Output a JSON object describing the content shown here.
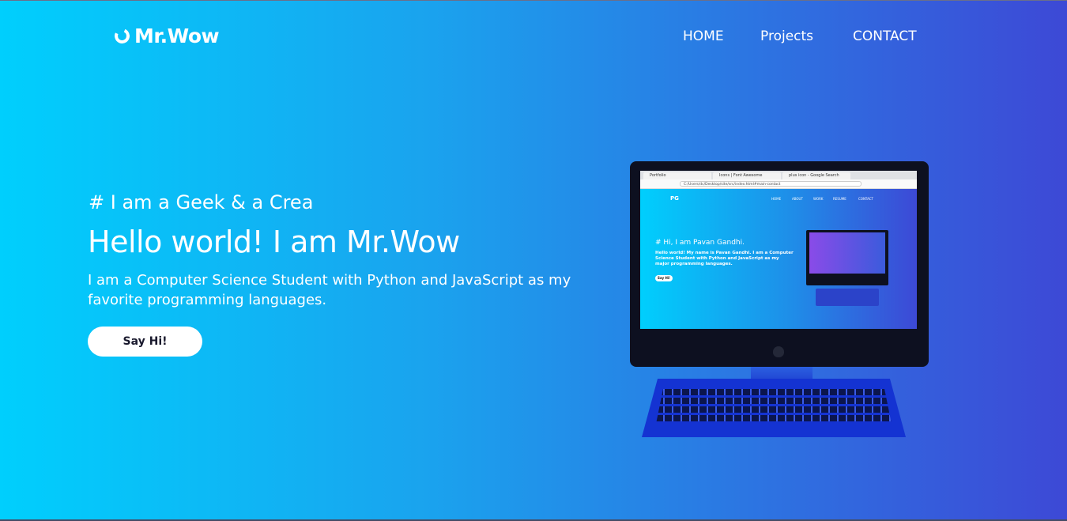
{
  "brand": {
    "name": "Mr.Wow",
    "icon": "ring-logo-icon"
  },
  "nav": {
    "items": [
      {
        "label": "HOME"
      },
      {
        "label": "Projects"
      },
      {
        "label": "CONTACT"
      }
    ]
  },
  "hero": {
    "tagline": "# I am a Geek & a Crea",
    "title": "Hello world! I am Mr.Wow",
    "description": "I am a Computer Science Student with Python and JavaScript as my favorite programming languages.",
    "cta_label": "Say Hi!"
  },
  "illustration": {
    "tabs": [
      "Portfolio",
      "Icons | Font Awesome",
      "plus icon - Google Search"
    ],
    "url": "C:/Users/dc/Desktop/site/src/index.html#main-contact",
    "inner_logo": "PG",
    "inner_nav": [
      "HOME",
      "ABOUT",
      "WORK",
      "RESUME",
      "CONTACT"
    ],
    "inner_title": "# Hi, I am Pavan Gandhi.",
    "inner_text": "Hello world! My name is Pavan Gandhi. I am a Computer Science Student with Python and JavaScript as my major programming languages.",
    "inner_button": "Say Hi!"
  },
  "colors": {
    "gradient_start": "#00cffd",
    "gradient_end": "#3d49d6",
    "button_bg": "#ffffff"
  }
}
